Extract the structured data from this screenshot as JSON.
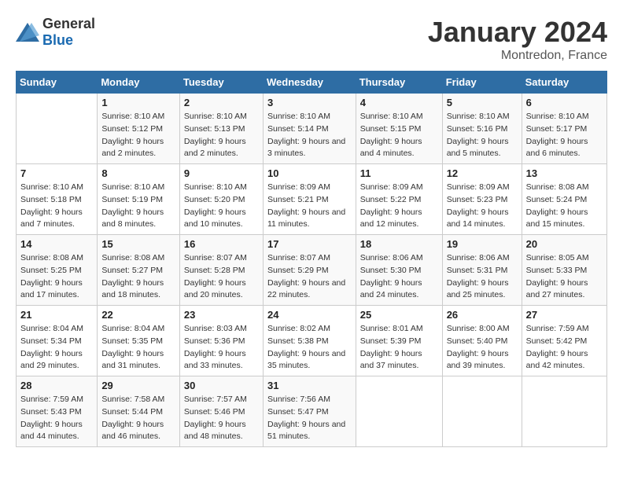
{
  "header": {
    "logo_general": "General",
    "logo_blue": "Blue",
    "month": "January 2024",
    "location": "Montredon, France"
  },
  "weekdays": [
    "Sunday",
    "Monday",
    "Tuesday",
    "Wednesday",
    "Thursday",
    "Friday",
    "Saturday"
  ],
  "weeks": [
    [
      {
        "day": "",
        "sunrise": "",
        "sunset": "",
        "daylight": ""
      },
      {
        "day": "1",
        "sunrise": "Sunrise: 8:10 AM",
        "sunset": "Sunset: 5:12 PM",
        "daylight": "Daylight: 9 hours and 2 minutes."
      },
      {
        "day": "2",
        "sunrise": "Sunrise: 8:10 AM",
        "sunset": "Sunset: 5:13 PM",
        "daylight": "Daylight: 9 hours and 2 minutes."
      },
      {
        "day": "3",
        "sunrise": "Sunrise: 8:10 AM",
        "sunset": "Sunset: 5:14 PM",
        "daylight": "Daylight: 9 hours and 3 minutes."
      },
      {
        "day": "4",
        "sunrise": "Sunrise: 8:10 AM",
        "sunset": "Sunset: 5:15 PM",
        "daylight": "Daylight: 9 hours and 4 minutes."
      },
      {
        "day": "5",
        "sunrise": "Sunrise: 8:10 AM",
        "sunset": "Sunset: 5:16 PM",
        "daylight": "Daylight: 9 hours and 5 minutes."
      },
      {
        "day": "6",
        "sunrise": "Sunrise: 8:10 AM",
        "sunset": "Sunset: 5:17 PM",
        "daylight": "Daylight: 9 hours and 6 minutes."
      }
    ],
    [
      {
        "day": "7",
        "sunrise": "Sunrise: 8:10 AM",
        "sunset": "Sunset: 5:18 PM",
        "daylight": "Daylight: 9 hours and 7 minutes."
      },
      {
        "day": "8",
        "sunrise": "Sunrise: 8:10 AM",
        "sunset": "Sunset: 5:19 PM",
        "daylight": "Daylight: 9 hours and 8 minutes."
      },
      {
        "day": "9",
        "sunrise": "Sunrise: 8:10 AM",
        "sunset": "Sunset: 5:20 PM",
        "daylight": "Daylight: 9 hours and 10 minutes."
      },
      {
        "day": "10",
        "sunrise": "Sunrise: 8:09 AM",
        "sunset": "Sunset: 5:21 PM",
        "daylight": "Daylight: 9 hours and 11 minutes."
      },
      {
        "day": "11",
        "sunrise": "Sunrise: 8:09 AM",
        "sunset": "Sunset: 5:22 PM",
        "daylight": "Daylight: 9 hours and 12 minutes."
      },
      {
        "day": "12",
        "sunrise": "Sunrise: 8:09 AM",
        "sunset": "Sunset: 5:23 PM",
        "daylight": "Daylight: 9 hours and 14 minutes."
      },
      {
        "day": "13",
        "sunrise": "Sunrise: 8:08 AM",
        "sunset": "Sunset: 5:24 PM",
        "daylight": "Daylight: 9 hours and 15 minutes."
      }
    ],
    [
      {
        "day": "14",
        "sunrise": "Sunrise: 8:08 AM",
        "sunset": "Sunset: 5:25 PM",
        "daylight": "Daylight: 9 hours and 17 minutes."
      },
      {
        "day": "15",
        "sunrise": "Sunrise: 8:08 AM",
        "sunset": "Sunset: 5:27 PM",
        "daylight": "Daylight: 9 hours and 18 minutes."
      },
      {
        "day": "16",
        "sunrise": "Sunrise: 8:07 AM",
        "sunset": "Sunset: 5:28 PM",
        "daylight": "Daylight: 9 hours and 20 minutes."
      },
      {
        "day": "17",
        "sunrise": "Sunrise: 8:07 AM",
        "sunset": "Sunset: 5:29 PM",
        "daylight": "Daylight: 9 hours and 22 minutes."
      },
      {
        "day": "18",
        "sunrise": "Sunrise: 8:06 AM",
        "sunset": "Sunset: 5:30 PM",
        "daylight": "Daylight: 9 hours and 24 minutes."
      },
      {
        "day": "19",
        "sunrise": "Sunrise: 8:06 AM",
        "sunset": "Sunset: 5:31 PM",
        "daylight": "Daylight: 9 hours and 25 minutes."
      },
      {
        "day": "20",
        "sunrise": "Sunrise: 8:05 AM",
        "sunset": "Sunset: 5:33 PM",
        "daylight": "Daylight: 9 hours and 27 minutes."
      }
    ],
    [
      {
        "day": "21",
        "sunrise": "Sunrise: 8:04 AM",
        "sunset": "Sunset: 5:34 PM",
        "daylight": "Daylight: 9 hours and 29 minutes."
      },
      {
        "day": "22",
        "sunrise": "Sunrise: 8:04 AM",
        "sunset": "Sunset: 5:35 PM",
        "daylight": "Daylight: 9 hours and 31 minutes."
      },
      {
        "day": "23",
        "sunrise": "Sunrise: 8:03 AM",
        "sunset": "Sunset: 5:36 PM",
        "daylight": "Daylight: 9 hours and 33 minutes."
      },
      {
        "day": "24",
        "sunrise": "Sunrise: 8:02 AM",
        "sunset": "Sunset: 5:38 PM",
        "daylight": "Daylight: 9 hours and 35 minutes."
      },
      {
        "day": "25",
        "sunrise": "Sunrise: 8:01 AM",
        "sunset": "Sunset: 5:39 PM",
        "daylight": "Daylight: 9 hours and 37 minutes."
      },
      {
        "day": "26",
        "sunrise": "Sunrise: 8:00 AM",
        "sunset": "Sunset: 5:40 PM",
        "daylight": "Daylight: 9 hours and 39 minutes."
      },
      {
        "day": "27",
        "sunrise": "Sunrise: 7:59 AM",
        "sunset": "Sunset: 5:42 PM",
        "daylight": "Daylight: 9 hours and 42 minutes."
      }
    ],
    [
      {
        "day": "28",
        "sunrise": "Sunrise: 7:59 AM",
        "sunset": "Sunset: 5:43 PM",
        "daylight": "Daylight: 9 hours and 44 minutes."
      },
      {
        "day": "29",
        "sunrise": "Sunrise: 7:58 AM",
        "sunset": "Sunset: 5:44 PM",
        "daylight": "Daylight: 9 hours and 46 minutes."
      },
      {
        "day": "30",
        "sunrise": "Sunrise: 7:57 AM",
        "sunset": "Sunset: 5:46 PM",
        "daylight": "Daylight: 9 hours and 48 minutes."
      },
      {
        "day": "31",
        "sunrise": "Sunrise: 7:56 AM",
        "sunset": "Sunset: 5:47 PM",
        "daylight": "Daylight: 9 hours and 51 minutes."
      },
      {
        "day": "",
        "sunrise": "",
        "sunset": "",
        "daylight": ""
      },
      {
        "day": "",
        "sunrise": "",
        "sunset": "",
        "daylight": ""
      },
      {
        "day": "",
        "sunrise": "",
        "sunset": "",
        "daylight": ""
      }
    ]
  ]
}
